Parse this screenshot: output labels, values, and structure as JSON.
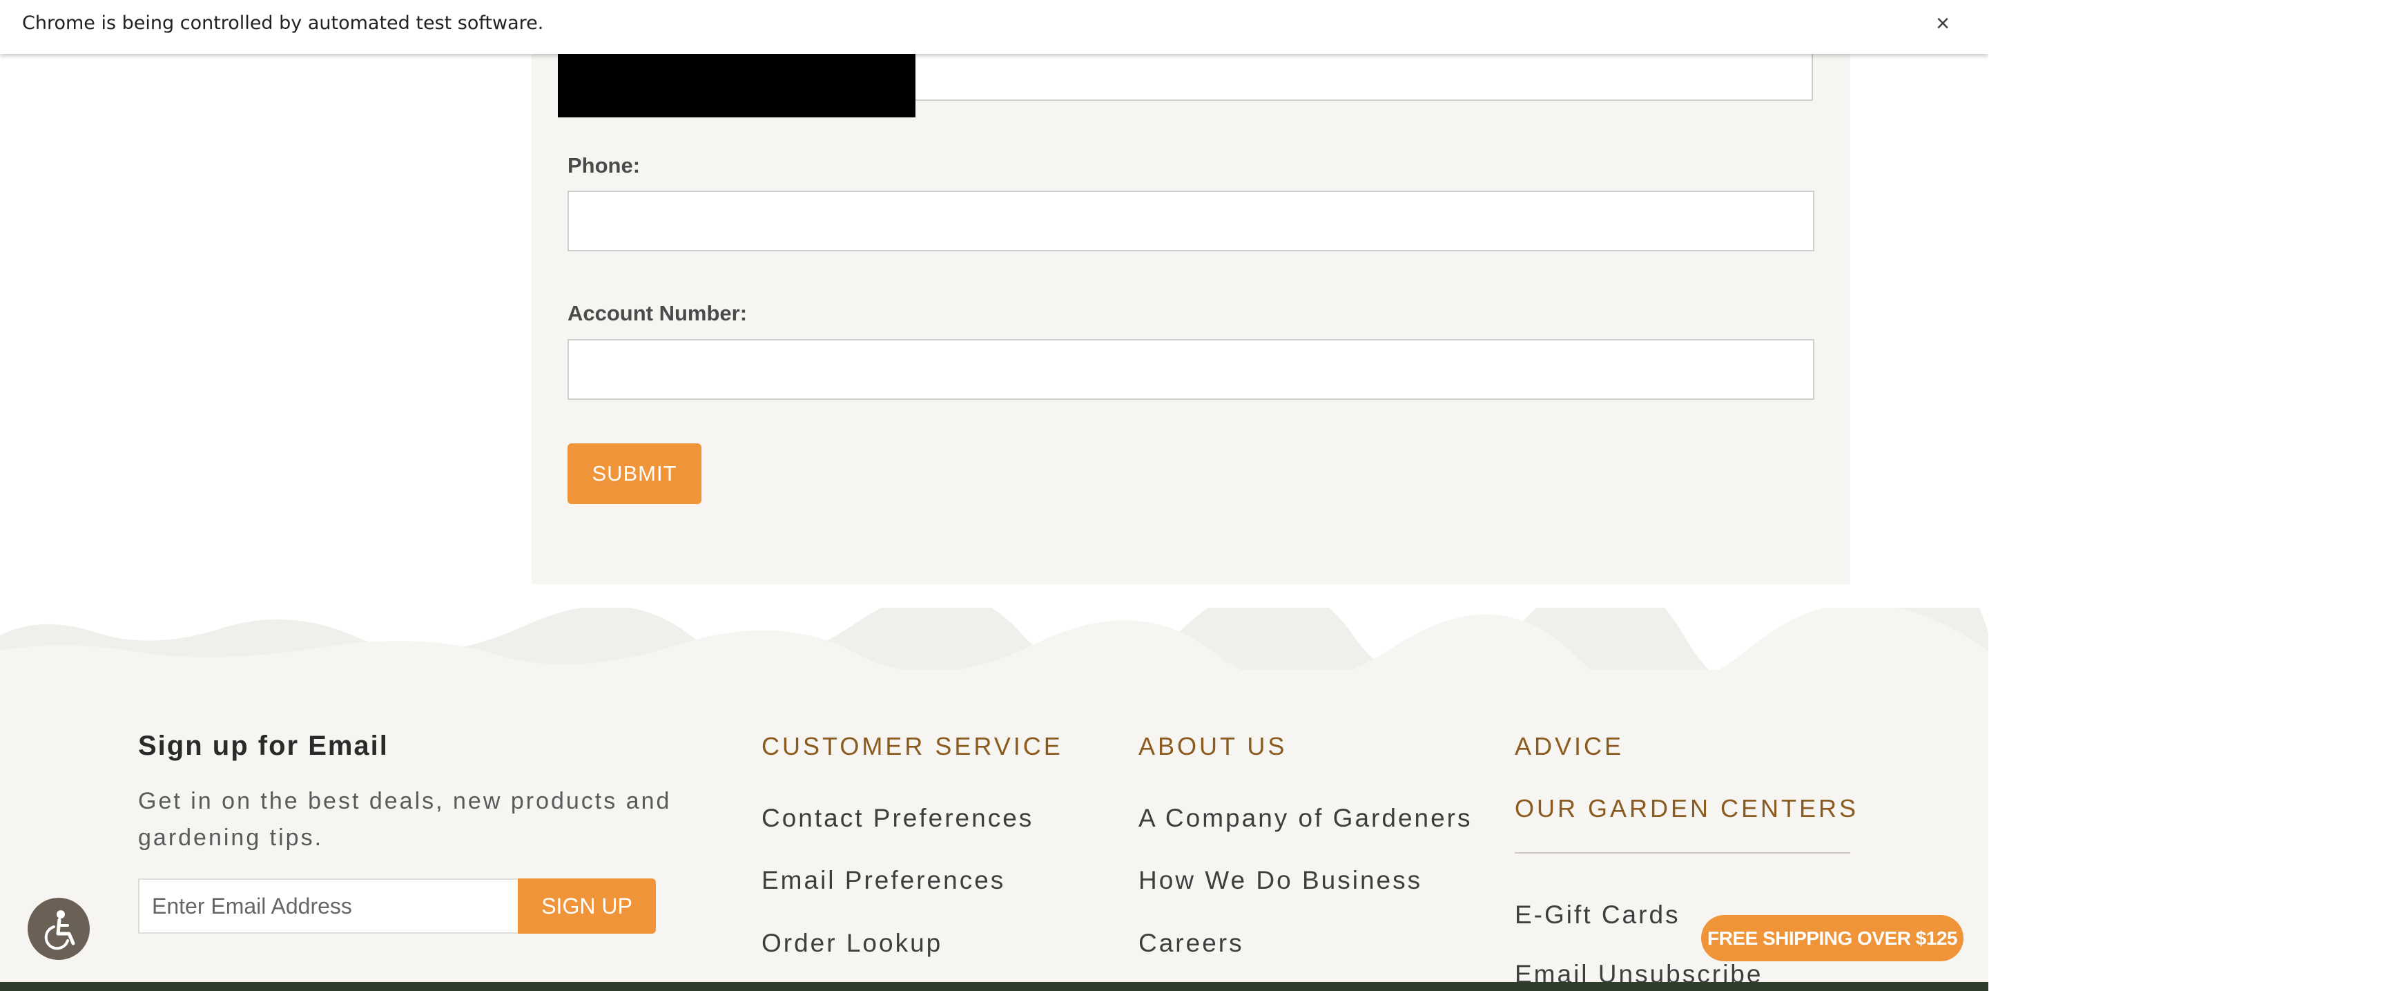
{
  "infobar": {
    "message": "Chrome is being controlled by automated test software.",
    "close_glyph": "×"
  },
  "form": {
    "phone_label": "Phone:",
    "account_label": "Account Number:",
    "submit_label": "SUBMIT"
  },
  "footer": {
    "signup": {
      "title": "Sign up for Email",
      "text": "Get in on the best deals, new products and gardening tips.",
      "placeholder": "Enter Email Address",
      "button_label": "SIGN UP"
    },
    "customer_service": {
      "heading": "CUSTOMER SERVICE",
      "links": [
        "Contact Preferences",
        "Email Preferences",
        "Order Lookup"
      ]
    },
    "about_us": {
      "heading": "ABOUT US",
      "links": [
        "A Company of Gardeners",
        "How We Do Business",
        "Careers"
      ]
    },
    "advice": {
      "heading": "ADVICE",
      "subheading": "OUR GARDEN CENTERS",
      "links": [
        "E-Gift Cards",
        "Email Unsubscribe"
      ]
    }
  },
  "widgets": {
    "accessibility_icon": "wheelchair-icon",
    "shipping_badge": "FREE SHIPPING OVER $125"
  },
  "colors": {
    "accent_orange": "#f0943a",
    "heading_brown": "#8a5a1e",
    "panel_bg": "#f6f5f2"
  }
}
